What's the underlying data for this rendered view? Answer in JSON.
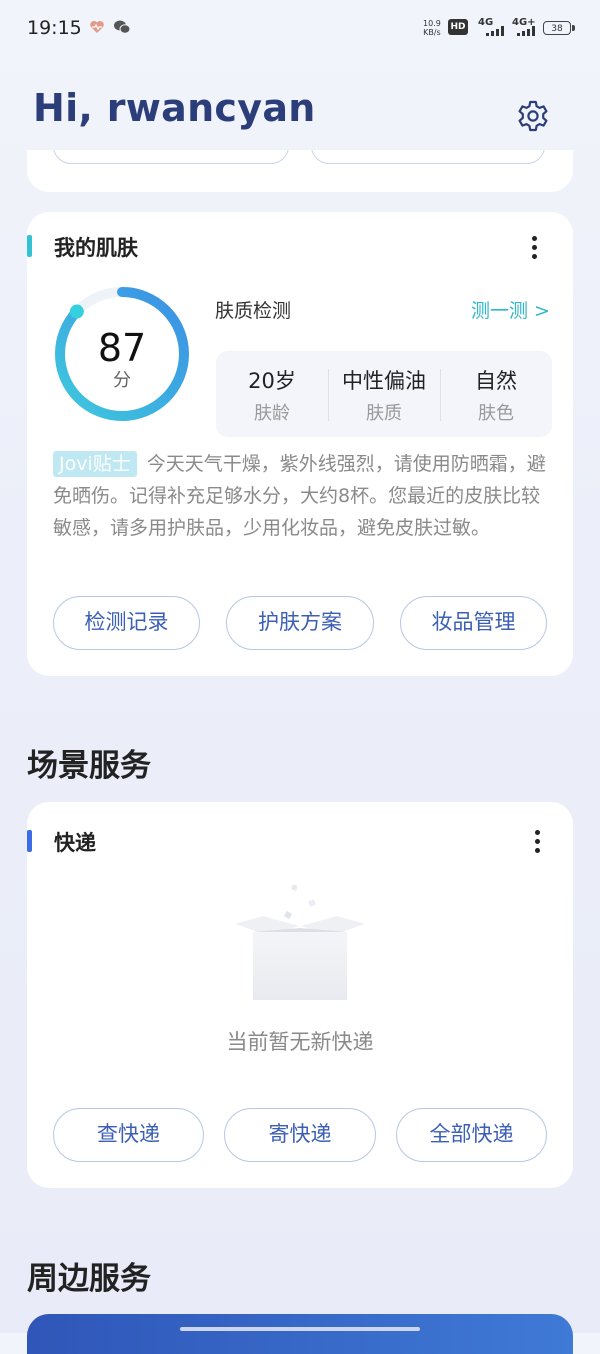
{
  "status_bar": {
    "time": "19:15",
    "net_speed": "10.9",
    "net_speed_unit": "KB/s",
    "hd": "HD",
    "net1": "4G",
    "net2": "4G+",
    "battery": "38"
  },
  "header": {
    "greeting": "Hi, rwancyan"
  },
  "skin_card": {
    "title": "我的肌肤",
    "score": "87",
    "score_unit": "分",
    "score_fraction": 0.87,
    "detect_label": "肤质检测",
    "detect_link": "测一测 >",
    "stats": [
      {
        "value": "20岁",
        "label": "肤龄"
      },
      {
        "value": "中性偏油",
        "label": "肤质"
      },
      {
        "value": "自然",
        "label": "肤色"
      }
    ],
    "tip_tag": "Jovi贴士",
    "tip_text": "今天天气干燥，紫外线强烈，请使用防晒霜，避免晒伤。记得补充足够水分，大约8杯。您最近的皮肤比较敏感，请多用护肤品，少用化妆品，避免皮肤过敏。",
    "buttons": [
      "检测记录",
      "护肤方案",
      "妆品管理"
    ]
  },
  "scene_section": {
    "title": "场景服务"
  },
  "express_card": {
    "title": "快递",
    "empty_text": "当前暂无新快递",
    "buttons": [
      "查快递",
      "寄快递",
      "全部快递"
    ]
  },
  "nearby_section": {
    "title": "周边服务"
  },
  "colors": {
    "greeting": "#2c3e79",
    "accent_cyan": "#2fb7c9",
    "accent_blue": "#3b6ee6",
    "pill_text": "#3b5fb5"
  }
}
